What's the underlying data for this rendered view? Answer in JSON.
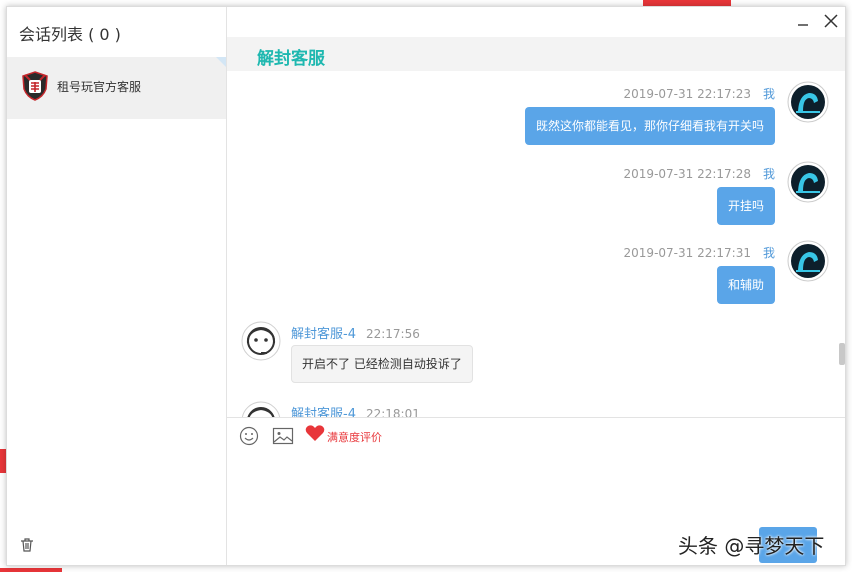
{
  "sidebar": {
    "title": "会话列表 ( 0 )",
    "conversations": [
      {
        "name": "租号玩官方客服"
      }
    ]
  },
  "chat": {
    "title": "解封客服",
    "messages": [
      {
        "from": "me",
        "sender": "我",
        "timestamp": "2019-07-31 22:17:23",
        "text": "既然这你都能看见，那你仔细看我有开关吗"
      },
      {
        "from": "me",
        "sender": "我",
        "timestamp": "2019-07-31 22:17:28",
        "text": "开挂吗"
      },
      {
        "from": "me",
        "sender": "我",
        "timestamp": "2019-07-31 22:17:31",
        "text": "和辅助"
      },
      {
        "from": "agent",
        "sender": "解封客服-4",
        "timestamp": "22:17:56",
        "text": "开启不了 已经检测自动投诉了"
      },
      {
        "from": "agent",
        "sender": "解封客服-4",
        "timestamp": "22:18:01",
        "text": ""
      }
    ]
  },
  "toolbar": {
    "rating_label": "满意度评价"
  },
  "watermark": "头条 @寻梦天下",
  "colors": {
    "accent": "#1fb8b0",
    "bubble_me": "#5aa5e8",
    "link_blue": "#4f98d8",
    "rating_red": "#e8363a"
  }
}
